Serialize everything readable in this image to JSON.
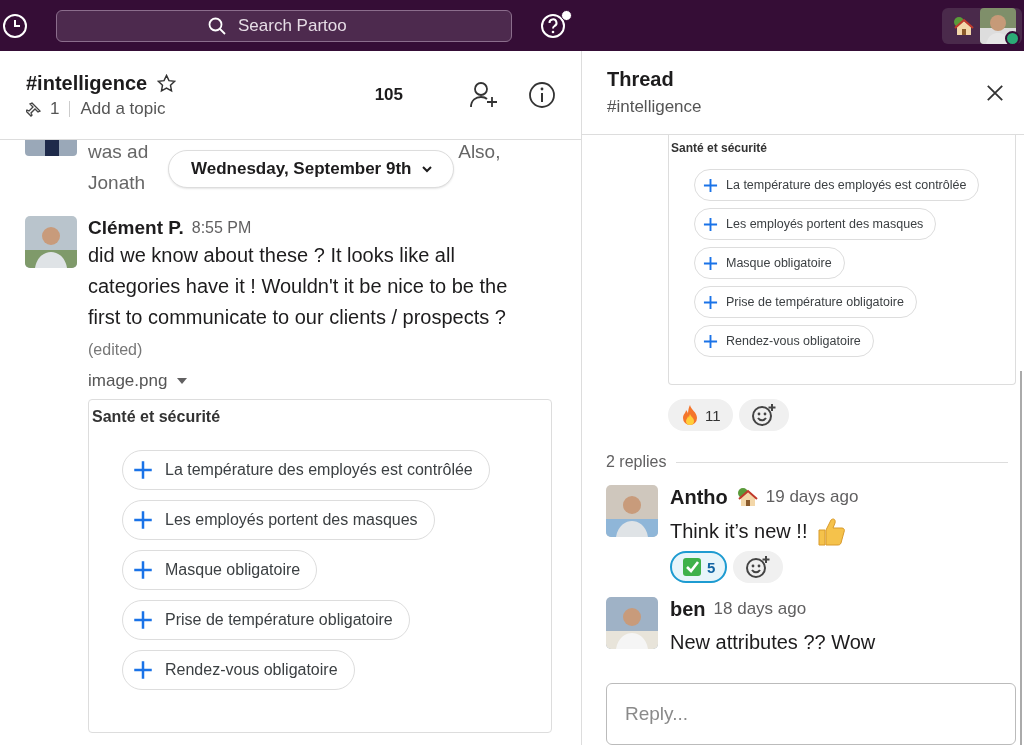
{
  "top_bar": {
    "search": {
      "placeholder": "Search Partoo"
    },
    "help_unread": true,
    "user_online": true
  },
  "channel": {
    "name": "#intelligence",
    "starred": false,
    "pins": "1",
    "topic_placeholder": "Add a topic",
    "member_count": "105"
  },
  "previous_message": {
    "line_1_start": "was ad",
    "line_1_end": "Also,",
    "line_2": "Jonath"
  },
  "date_divider": "Wednesday, September 9th",
  "message": {
    "author": "Clément P.",
    "time": "8:55 PM",
    "text": "did we know about these ? It looks like all categories have it ! Wouldn't it be nice to be the first to communicate to our clients / prospects ?",
    "edited": "(edited)",
    "attachment": {
      "filename": "image.png",
      "card_title": "Santé et sécurité",
      "chips": [
        "La température des employés est contrôlée",
        "Les employés portent des masques",
        "Masque obligatoire",
        "Prise de température obligatoire",
        "Rendez-vous obligatoire"
      ]
    }
  },
  "thread": {
    "title": "Thread",
    "channel": "#intelligence",
    "card_title": "Santé et sécurité",
    "chips": [
      "La température des employés est contrôlée",
      "Les employés portent des masques",
      "Masque obligatoire",
      "Prise de température obligatoire",
      "Rendez-vous obligatoire"
    ],
    "reactions": [
      {
        "kind": "fire",
        "count": "11",
        "selected": false
      }
    ],
    "replies_count": "2 replies",
    "replies": [
      {
        "author": "Antho",
        "status_icon": true,
        "time": "19 days ago",
        "text": "Think it’s new !!",
        "trailing_icon": true,
        "reactions": [
          {
            "kind": "check",
            "count": "5",
            "selected": true
          }
        ]
      },
      {
        "author": "ben",
        "time": "18 days ago",
        "text": "New attributes ?? Wow"
      }
    ],
    "reply_placeholder": "Reply..."
  }
}
